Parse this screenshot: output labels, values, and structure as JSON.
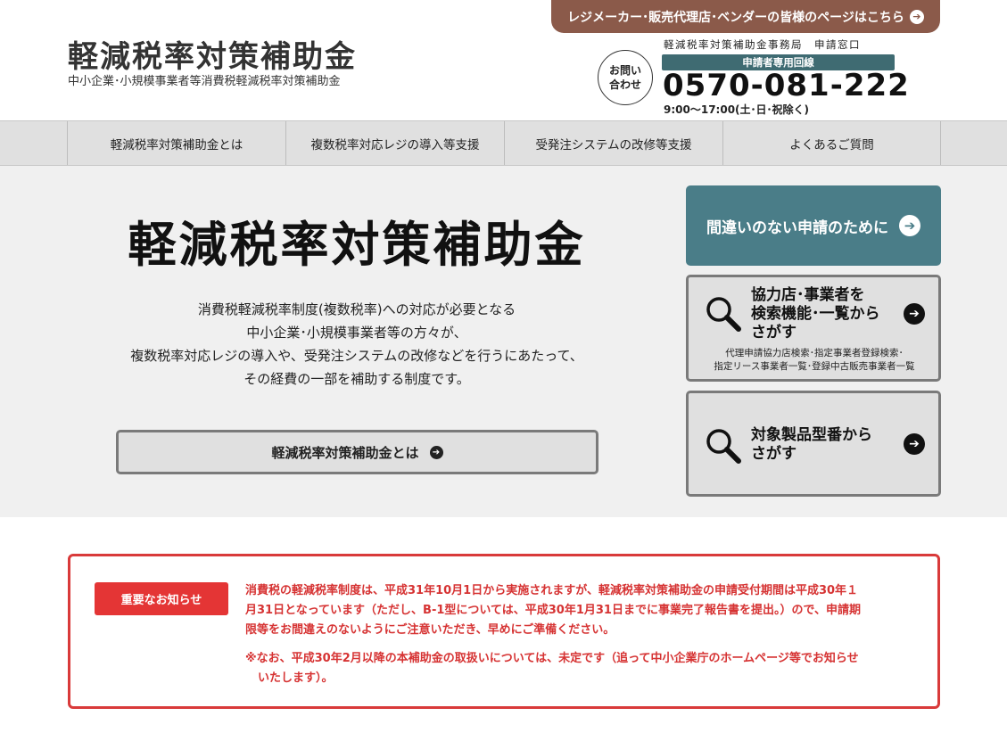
{
  "header": {
    "title": "軽減税率対策補助金",
    "subtitle": "中小企業･小規模事業者等消費税軽減税率対策補助金",
    "vendor_link": "レジメーカー･販売代理店･ベンダーの皆様のページはこちら",
    "contact_label_1": "お問い",
    "contact_label_2": "合わせ",
    "office_name": "軽減税率対策補助金事務局　申請窓口",
    "line_badge": "申請者専用回線",
    "phone": "0570-081-222",
    "hours": "9:00〜17:00(土･日･祝除く)"
  },
  "nav": {
    "items": [
      {
        "label": "軽減税率対策補助金とは"
      },
      {
        "label": "複数税率対応レジの導入等支援"
      },
      {
        "label": "受発注システムの改修等支援"
      },
      {
        "label": "よくあるご質問"
      }
    ]
  },
  "hero": {
    "title": "軽減税率対策補助金",
    "description": [
      "消費税軽減税率制度(複数税率)への対応が必要となる",
      "中小企業･小規模事業者等の方々が、",
      "複数税率対応レジの導入や、受発注システムの改修などを行うにあたって、",
      "その経費の一部を補助する制度です。"
    ],
    "button_label": "軽減税率対策補助金とは"
  },
  "side": {
    "card1_label": "間違いのない申請のために",
    "card2_lines": [
      "協力店･事業者を",
      "検索機能･一覧から",
      "さがす"
    ],
    "card2_sub": [
      "代理申請協力店検索･指定事業者登録検索･",
      "指定リース事業者一覧･登録中古販売事業者一覧"
    ],
    "card3_lines": [
      "対象製品型番から",
      "さがす"
    ]
  },
  "notice": {
    "badge": "重要なお知らせ",
    "paragraph1": [
      "消費税の軽減税率制度は、平成31年10月1日から実施されますが、軽減税率対策補助金の申請受付期間は平成30年１",
      "月31日となっています（ただし、B-1型については、平成30年1月31日までに事業完了報告書を提出。）ので、申請期",
      "限等をお間違えのないようにご注意いただき、早めにご準備ください。"
    ],
    "paragraph2": [
      "※なお、平成30年2月以降の本補助金の取扱いについては、未定です（追って中小企業庁のホームページ等でお知らせ",
      "いたします）。"
    ]
  },
  "colors": {
    "vendor_link_bg": "#8b5a4a",
    "line_badge_bg": "#3f6b72",
    "side_card1_bg": "#4a7d88",
    "notice_red": "#d93a3a"
  }
}
